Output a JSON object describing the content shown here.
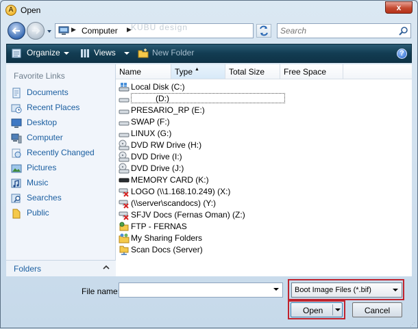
{
  "window": {
    "title": "Open",
    "app_icon_letter": "A",
    "close_label": "x"
  },
  "nav": {
    "address": {
      "root": "Computer"
    },
    "watermark": "KUBU design",
    "search": {
      "placeholder": "Search"
    }
  },
  "toolbar": {
    "organize": "Organize",
    "views": "Views",
    "new_folder": "New Folder",
    "help": "?"
  },
  "sidebar": {
    "heading": "Favorite Links",
    "items": [
      {
        "label": "Documents",
        "icon": "documents-icon"
      },
      {
        "label": "Recent Places",
        "icon": "recent-places-icon"
      },
      {
        "label": "Desktop",
        "icon": "desktop-icon"
      },
      {
        "label": "Computer",
        "icon": "computer-icon"
      },
      {
        "label": "Recently Changed",
        "icon": "recently-changed-icon"
      },
      {
        "label": "Pictures",
        "icon": "pictures-icon"
      },
      {
        "label": "Music",
        "icon": "music-icon"
      },
      {
        "label": "Searches",
        "icon": "searches-icon"
      },
      {
        "label": "Public",
        "icon": "public-icon"
      }
    ],
    "folders": "Folders"
  },
  "columns": [
    "Name",
    "Type",
    "Total Size",
    "Free Space"
  ],
  "files": [
    {
      "name": "Local Disk (C:)",
      "icon": "local-disk-icon"
    },
    {
      "name": "(D:)",
      "icon": "drive-icon"
    },
    {
      "name": "PRESARIO_RP (E:)",
      "icon": "drive-icon"
    },
    {
      "name": "SWAP (F:)",
      "icon": "drive-icon"
    },
    {
      "name": "LINUX (G:)",
      "icon": "drive-icon"
    },
    {
      "name": "DVD RW Drive (H:)",
      "icon": "dvd-drive-icon"
    },
    {
      "name": "DVD Drive (I:)",
      "icon": "dvd-drive-icon"
    },
    {
      "name": "DVD Drive (J:)",
      "icon": "dvd-drive-icon"
    },
    {
      "name": "MEMORY CARD (K:)",
      "icon": "memory-card-icon"
    },
    {
      "name": "LOGO (\\\\1.168.10.249) (X:)",
      "icon": "disconnected-network-drive-icon"
    },
    {
      "name": "(\\\\server\\scandocs) (Y:)",
      "icon": "disconnected-network-drive-icon"
    },
    {
      "name": "SFJV Docs (Fernas Oman) (Z:)",
      "icon": "disconnected-network-drive-icon"
    },
    {
      "name": "FTP - FERNAS",
      "icon": "ftp-folder-icon"
    },
    {
      "name": "My Sharing Folders",
      "icon": "sharing-folders-icon"
    },
    {
      "name": "Scan Docs (Server)",
      "icon": "network-folder-icon"
    }
  ],
  "bottom": {
    "file_name_label": "File name:",
    "file_name_value": "",
    "file_type": "Boot Image Files (*.bif)",
    "open": "Open",
    "cancel": "Cancel"
  },
  "colors": {
    "toolbar": "#123c52",
    "link": "#1a5ea0",
    "highlight": "#c0232e"
  }
}
